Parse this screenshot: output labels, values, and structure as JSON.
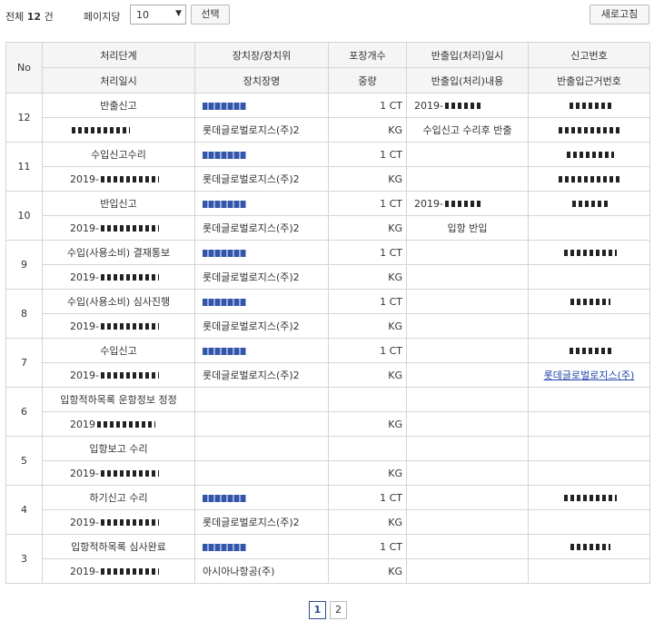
{
  "toolbar": {
    "total_prefix": "전체",
    "total_count": "12",
    "total_suffix": "건",
    "per_page_label": "페이지당",
    "per_page_value": "10",
    "select_button": "선택",
    "refresh_button": "새로고침"
  },
  "columns": {
    "no": "No",
    "stage": "처리단계",
    "stage_date": "처리일시",
    "warehouse": "장치장/장치위",
    "warehouse_name": "장치장명",
    "packages": "포장개수",
    "weight": "중량",
    "inout_date": "반출입(처리)일시",
    "inout_content": "반출입(처리)내용",
    "decl_no": "신고번호",
    "inout_ref": "반출입근거번호"
  },
  "rows": [
    {
      "no": "12",
      "stage": "반출신고",
      "date": "",
      "warehouse": "",
      "warehouse_name": "롯데글로벌로지스(주)2",
      "packages": "1 CT",
      "weight": "KG",
      "inout_date": "2019-",
      "inout_content": "수입신고 수리후 반출",
      "decl_no": "",
      "inout_ref": ""
    },
    {
      "no": "11",
      "stage": "수입신고수리",
      "date": "2019-",
      "warehouse": "",
      "warehouse_name": "롯데글로벌로지스(주)2",
      "packages": "1 CT",
      "weight": "KG",
      "inout_date": "",
      "inout_content": "",
      "decl_no": "",
      "inout_ref": ""
    },
    {
      "no": "10",
      "stage": "반입신고",
      "date": "2019-",
      "warehouse": "",
      "warehouse_name": "롯데글로벌로지스(주)2",
      "packages": "1 CT",
      "weight": "KG",
      "inout_date": "2019-",
      "inout_content": "입항 반입",
      "decl_no": "",
      "inout_ref": ""
    },
    {
      "no": "9",
      "stage": "수입(사용소비) 결재통보",
      "date": "2019-",
      "warehouse": "",
      "warehouse_name": "롯데글로벌로지스(주)2",
      "packages": "1 CT",
      "weight": "KG",
      "inout_date": "",
      "inout_content": "",
      "decl_no": "",
      "inout_ref": ""
    },
    {
      "no": "8",
      "stage": "수입(사용소비) 심사진행",
      "date": "2019-",
      "warehouse": "",
      "warehouse_name": "롯데글로벌로지스(주)2",
      "packages": "1 CT",
      "weight": "KG",
      "inout_date": "",
      "inout_content": "",
      "decl_no": "",
      "inout_ref": ""
    },
    {
      "no": "7",
      "stage": "수입신고",
      "date": "2019-",
      "warehouse": "",
      "warehouse_name": "롯데글로벌로지스(주)2",
      "packages": "1 CT",
      "weight": "KG",
      "inout_date": "",
      "inout_content": "",
      "decl_no": "",
      "inout_ref": "롯데글로벌로지스(주)"
    },
    {
      "no": "6",
      "stage": "입항적하목록 운항정보 정정",
      "date": "2019",
      "warehouse": "",
      "warehouse_name": "",
      "packages": "",
      "weight": "KG",
      "inout_date": "",
      "inout_content": "",
      "decl_no": "",
      "inout_ref": ""
    },
    {
      "no": "5",
      "stage": "입항보고 수리",
      "date": "2019-",
      "warehouse": "",
      "warehouse_name": "",
      "packages": "",
      "weight": "KG",
      "inout_date": "",
      "inout_content": "",
      "decl_no": "",
      "inout_ref": ""
    },
    {
      "no": "4",
      "stage": "하기신고 수리",
      "date": "2019-",
      "warehouse": "",
      "warehouse_name": "롯데글로벌로지스(주)2",
      "packages": "1 CT",
      "weight": "KG",
      "inout_date": "",
      "inout_content": "",
      "decl_no": "",
      "inout_ref": ""
    },
    {
      "no": "3",
      "stage": "입항적하목록 심사완료",
      "date": "2019-",
      "warehouse": "",
      "warehouse_name": "아시아나항공(주)",
      "packages": "1 CT",
      "weight": "KG",
      "inout_date": "",
      "inout_content": "",
      "decl_no": "",
      "inout_ref": ""
    }
  ],
  "pagination": {
    "pages": [
      "1",
      "2"
    ],
    "current": "1"
  }
}
